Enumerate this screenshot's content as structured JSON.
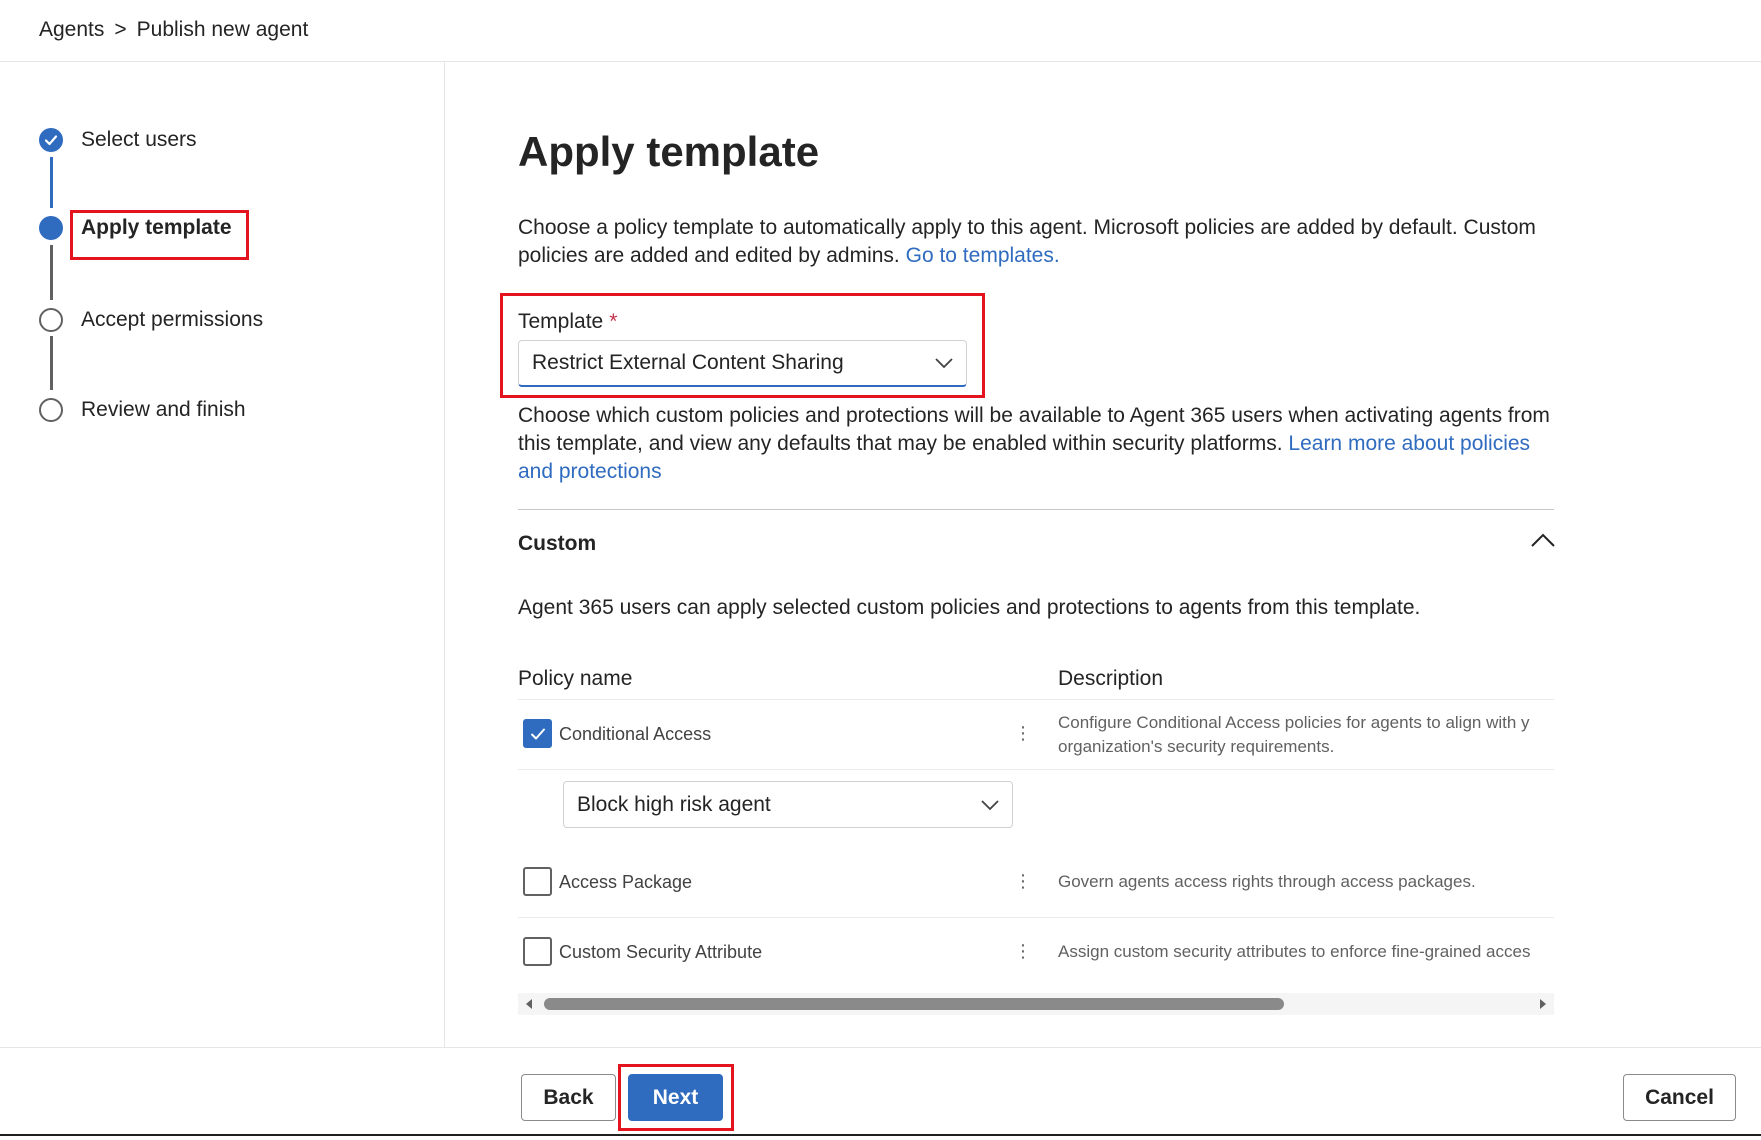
{
  "breadcrumb": {
    "root": "Agents",
    "separator": ">",
    "current": "Publish new agent"
  },
  "steps": [
    {
      "label": "Select users",
      "state": "completed"
    },
    {
      "label": "Apply template",
      "state": "current"
    },
    {
      "label": "Accept permissions",
      "state": "pending"
    },
    {
      "label": "Review and finish",
      "state": "pending"
    }
  ],
  "page": {
    "title": "Apply template",
    "intro_text": "Choose a policy template to automatically apply to this agent. Microsoft policies are added by default. Custom policies are added and edited by admins.",
    "intro_link": "Go to templates.",
    "template_label": "Template",
    "required_marker": "*",
    "template_value": "Restrict External Content Sharing",
    "template_help_text": "Choose which custom policies and protections will be available to Agent 365 users when activating agents from this template, and view any defaults that may be enabled within security platforms.",
    "template_help_link": "Learn more about policies and protections"
  },
  "custom_section": {
    "title": "Custom",
    "expanded": true,
    "description": "Agent 365 users can apply selected custom policies and protections to agents from this template.",
    "columns": [
      "Policy name",
      "Description"
    ],
    "policies": [
      {
        "name": "Conditional Access",
        "checked": true,
        "more_icon": "⋮",
        "description_line1": "Configure Conditional Access policies for agents to align with y",
        "description_line2": "organization's security requirements.",
        "sub_select": "Block high risk agent"
      },
      {
        "name": "Access Package",
        "checked": false,
        "more_icon": "⋮",
        "description_line1": "Govern agents access rights through access packages."
      },
      {
        "name": "Custom Security Attribute",
        "checked": false,
        "more_icon": "⋮",
        "description_line1": "Assign custom security attributes to enforce fine-grained acces"
      }
    ]
  },
  "footer": {
    "back_label": "Back",
    "next_label": "Next",
    "cancel_label": "Cancel"
  },
  "colors": {
    "accent": "#2f6bbf",
    "highlight": "#e3141e"
  }
}
